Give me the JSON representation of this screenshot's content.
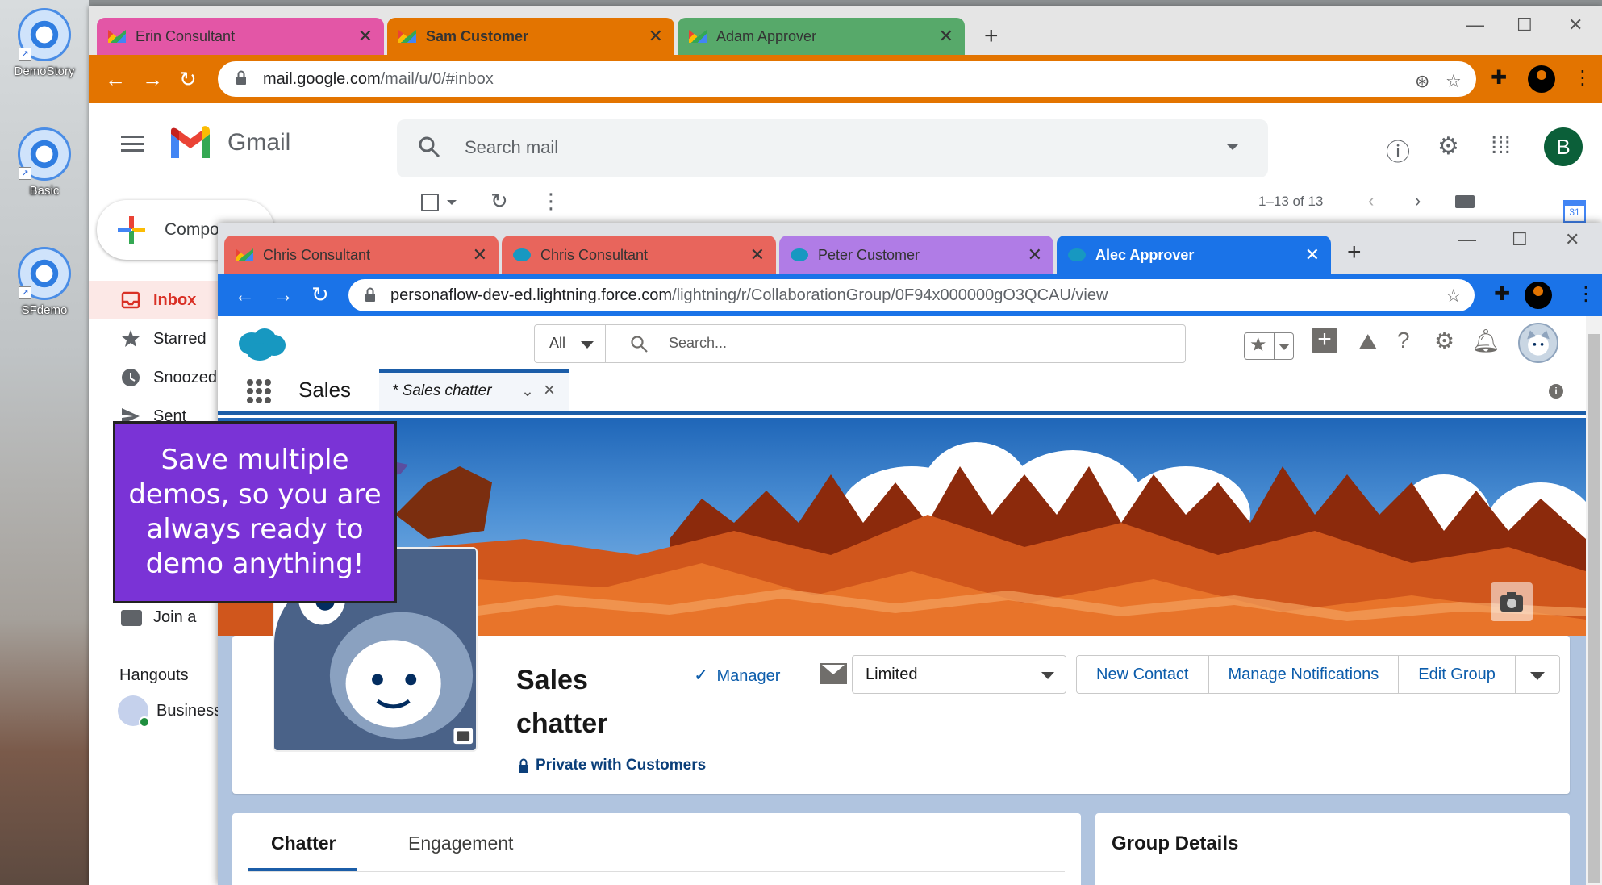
{
  "desktop": {
    "icons": [
      {
        "label": "DemoStory"
      },
      {
        "label": "Basic"
      },
      {
        "label": "SFdemo"
      }
    ]
  },
  "gmail_window": {
    "tabs": [
      {
        "label": "Erin  Consultant",
        "color": "#e356a6"
      },
      {
        "label": "Sam Customer",
        "color": "#e37400"
      },
      {
        "label": "Adam Approver",
        "color": "#57a96a"
      }
    ],
    "url_host": "mail.google.com",
    "url_path": "/mail/u/0/#inbox",
    "accent": "#e37400",
    "app_name": "Gmail",
    "search_placeholder": "Search mail",
    "avatar_letter": "B",
    "pagination": "1–13 of 13",
    "compose_label": "Compose",
    "nav": [
      {
        "label": "Inbox",
        "icon": "inbox-icon"
      },
      {
        "label": "Starred",
        "icon": "star-icon"
      },
      {
        "label": "Snoozed",
        "icon": "clock-icon"
      },
      {
        "label": "Sent",
        "icon": "send-icon"
      }
    ],
    "join_label": "Join a",
    "hangouts_label": "Hangouts",
    "hangouts_user": "Business",
    "calendar_day": "31"
  },
  "callout": {
    "text": "Save multiple demos, so you are always ready to demo anything!",
    "color": "#7a33d6"
  },
  "sf_window": {
    "tabs": [
      {
        "label": "Chris Consultant",
        "color": "#e8655c",
        "favicon": "gmail"
      },
      {
        "label": "Chris Consultant",
        "color": "#e8655c",
        "favicon": "salesforce"
      },
      {
        "label": "Peter Customer",
        "color": "#b07ce6",
        "favicon": "salesforce"
      },
      {
        "label": "Alec Approver",
        "color": "#1a73e8",
        "favicon": "salesforce"
      }
    ],
    "url_host": "personaflow-dev-ed.lightning.force.com",
    "url_path": "/lightning/r/CollaborationGroup/0F94x000000gO3QCAU/view",
    "accent": "#1a73e8",
    "search_scope": "All",
    "search_placeholder": "Search...",
    "app_name": "Sales",
    "active_tab": "* Sales chatter",
    "group": {
      "title": "Sales chatter",
      "privacy": "Private with Customers",
      "role": "Manager",
      "email_setting": "Limited",
      "actions": [
        "New Contact",
        "Manage Notifications",
        "Edit Group"
      ]
    },
    "content_tabs": [
      "Chatter",
      "Engagement"
    ],
    "details_title": "Group Details"
  }
}
